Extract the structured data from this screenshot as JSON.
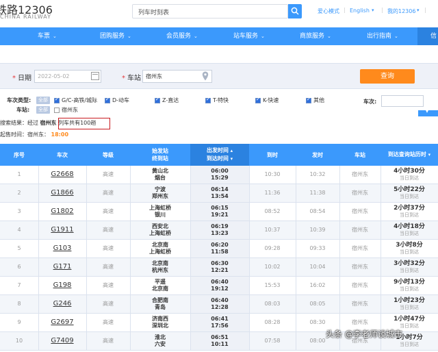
{
  "header": {
    "logo_title": "铁路12306",
    "logo_sub": "CHINA RAILWAY",
    "search_text": "列车时刻表",
    "links": [
      "爱心模式",
      "English",
      "我的12306"
    ]
  },
  "nav": {
    "items": [
      "车票",
      "团购服务",
      "会员服务",
      "站车服务",
      "商旅服务",
      "出行指南",
      "信"
    ]
  },
  "query": {
    "date_label": "日期",
    "date_value": "2022-05-02",
    "station_label": "车站",
    "station_value": "宿州东",
    "query_button": "查询"
  },
  "filters": {
    "type_label": "车次类型:",
    "all_label": "全部",
    "types": [
      "G/C-高铁/城际",
      "D-动车",
      "Z-直达",
      "T-特快",
      "K-快速",
      "其他"
    ],
    "station_label": "车站:",
    "station_option": "宿州东",
    "trainno_label": "车次:"
  },
  "result": {
    "prefix": "搜索结果：经过",
    "station": "宿州东",
    "count_text": "列车共有100趟",
    "sale_prefix": "起售时间：宿州东：",
    "sale_time": "18:00"
  },
  "table": {
    "headers": {
      "seq": "序号",
      "train": "车次",
      "grade": "等级",
      "station1": "始发站",
      "station2": "终到站",
      "dep1": "出发时间",
      "dep2": "到达时间",
      "arr": "到时",
      "leave": "发时",
      "stn": "车站",
      "dur": "到达查询站历时"
    },
    "rows": [
      {
        "seq": "1",
        "train": "G2668",
        "grade": "高速",
        "from": "黄山北",
        "to": "烟台",
        "dep": "06:00",
        "arrv": "15:29",
        "arr": "10:30",
        "leave": "10:32",
        "stn": "宿州东",
        "dur": "4小时30分",
        "day": "当日到达"
      },
      {
        "seq": "2",
        "train": "G1866",
        "grade": "高速",
        "from": "宁波",
        "to": "郑州东",
        "dep": "06:14",
        "arrv": "13:54",
        "arr": "11:36",
        "leave": "11:38",
        "stn": "宿州东",
        "dur": "5小时22分",
        "day": "当日到达"
      },
      {
        "seq": "3",
        "train": "G1802",
        "grade": "高速",
        "from": "上海虹桥",
        "to": "银川",
        "dep": "06:15",
        "arrv": "19:21",
        "arr": "08:52",
        "leave": "08:54",
        "stn": "宿州东",
        "dur": "2小时37分",
        "day": "当日到达"
      },
      {
        "seq": "4",
        "train": "G1911",
        "grade": "高速",
        "from": "西安北",
        "to": "上海虹桥",
        "dep": "06:19",
        "arrv": "13:23",
        "arr": "10:37",
        "leave": "10:39",
        "stn": "宿州东",
        "dur": "4小时18分",
        "day": "当日到达"
      },
      {
        "seq": "5",
        "train": "G103",
        "grade": "高速",
        "from": "北京南",
        "to": "上海虹桥",
        "dep": "06:20",
        "arrv": "11:58",
        "arr": "09:28",
        "leave": "09:33",
        "stn": "宿州东",
        "dur": "3小时8分",
        "day": "当日到达"
      },
      {
        "seq": "6",
        "train": "G171",
        "grade": "高速",
        "from": "北京南",
        "to": "杭州东",
        "dep": "06:30",
        "arrv": "12:21",
        "arr": "10:02",
        "leave": "10:04",
        "stn": "宿州东",
        "dur": "3小时32分",
        "day": "当日到达"
      },
      {
        "seq": "7",
        "train": "G198",
        "grade": "高速",
        "from": "平遥",
        "to": "北京南",
        "dep": "06:40",
        "arrv": "19:12",
        "arr": "15:53",
        "leave": "16:02",
        "stn": "宿州东",
        "dur": "9小时13分",
        "day": "当日到达"
      },
      {
        "seq": "8",
        "train": "G246",
        "grade": "高速",
        "from": "合肥南",
        "to": "青岛",
        "dep": "06:40",
        "arrv": "12:28",
        "arr": "08:03",
        "leave": "08:05",
        "stn": "宿州东",
        "dur": "1小时23分",
        "day": "当日到达"
      },
      {
        "seq": "9",
        "train": "G2697",
        "grade": "高速",
        "from": "济南西",
        "to": "深圳北",
        "dep": "06:41",
        "arrv": "17:56",
        "arr": "08:28",
        "leave": "08:30",
        "stn": "宿州东",
        "dur": "1小时47分",
        "day": "当日到达"
      },
      {
        "seq": "10",
        "train": "G7409",
        "grade": "高速",
        "from": "淮北",
        "to": "六安",
        "dep": "06:51",
        "arrv": "10:11",
        "arr": "07:58",
        "leave": "08:00",
        "stn": "宿州东",
        "dur": "1小时7分",
        "day": "当日到达"
      }
    ]
  },
  "watermark": "头条 @李老师谈城市"
}
